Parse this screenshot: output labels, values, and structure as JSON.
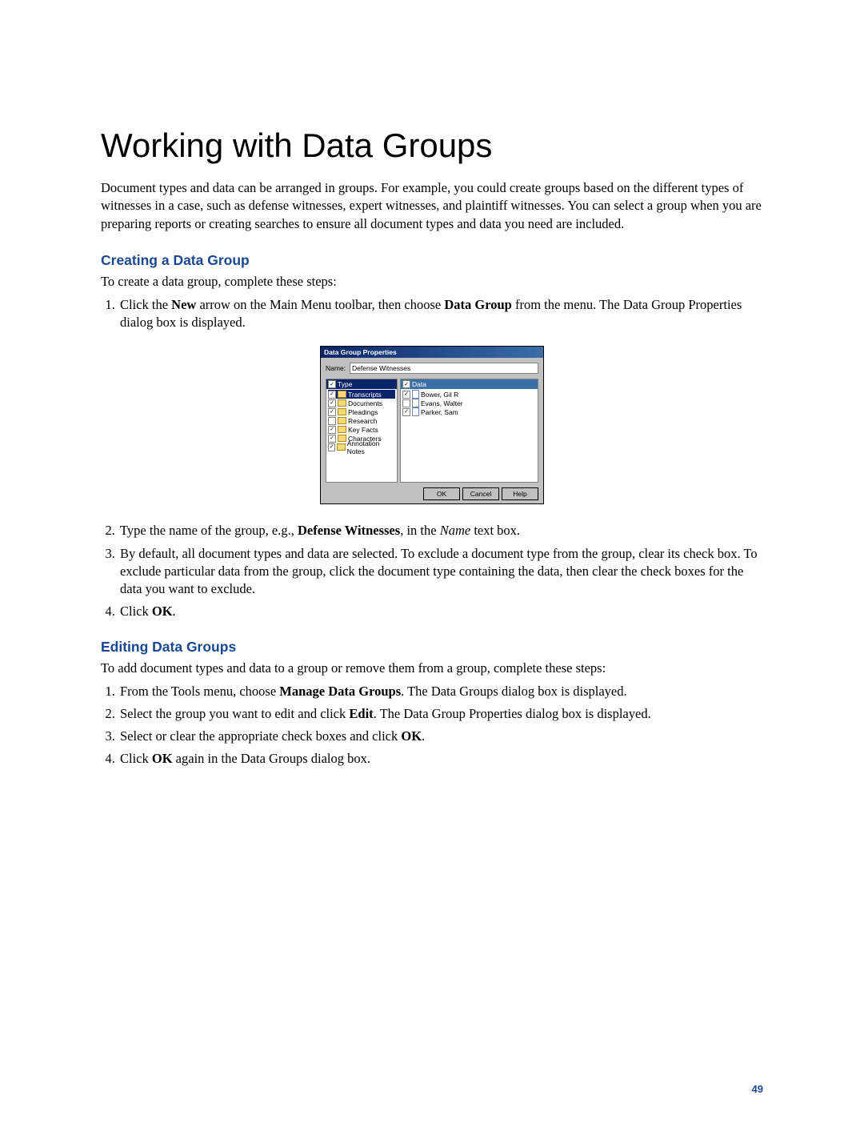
{
  "title": "Working with Data Groups",
  "intro": "Document types and data can be arranged in groups. For example, you could create groups based on the different types of witnesses in a case, such as defense witnesses, expert witnesses, and plaintiff witnesses. You can select a group when you are preparing reports or creating searches to ensure all document types and data you need are included.",
  "section_create": {
    "heading": "Creating a Data Group",
    "lead": "To create a data group, complete these steps:",
    "steps": {
      "s1_a": "Click the ",
      "s1_b": "New",
      "s1_c": " arrow on the Main Menu toolbar, then choose ",
      "s1_d": "Data Group",
      "s1_e": " from the menu. The Data Group Properties dialog box is displayed.",
      "s2_a": "Type the name of the group, e.g., ",
      "s2_b": "Defense Witnesses",
      "s2_c": ", in the ",
      "s2_d": "Name",
      "s2_e": " text box.",
      "s3": "By default, all document types and data are selected. To exclude a document type from the group, clear its check box. To exclude particular data from the group, click the document type containing the data, then clear the check boxes for the data you want to exclude.",
      "s4_a": "Click ",
      "s4_b": "OK",
      "s4_c": "."
    }
  },
  "section_edit": {
    "heading": "Editing Data Groups",
    "lead": "To add document types and data to a group or remove them from a group, complete these steps:",
    "steps": {
      "s1_a": "From the Tools menu, choose ",
      "s1_b": "Manage Data Groups",
      "s1_c": ". The Data Groups dialog box is displayed.",
      "s2_a": "Select the group you want to edit and click ",
      "s2_b": "Edit",
      "s2_c": ". The Data Group Properties dialog box is displayed.",
      "s3_a": "Select or clear the appropriate check boxes and click ",
      "s3_b": "OK",
      "s3_c": ".",
      "s4_a": "Click ",
      "s4_b": "OK",
      "s4_c": " again in the Data Groups dialog box."
    }
  },
  "dialog": {
    "title": "Data Group Properties",
    "name_label": "Name:",
    "name_value": "Defense Witnesses",
    "type_label": "Type",
    "data_label": "Data",
    "types": [
      {
        "label": "Transcripts",
        "checked": true,
        "selected": true
      },
      {
        "label": "Documents",
        "checked": true
      },
      {
        "label": "Pleadings",
        "checked": true
      },
      {
        "label": "Research",
        "checked": false
      },
      {
        "label": "Key Facts",
        "checked": true
      },
      {
        "label": "Characters",
        "checked": true
      },
      {
        "label": "Annotation Notes",
        "checked": true
      }
    ],
    "data_items": [
      {
        "label": "Bower, Gil R",
        "checked": true
      },
      {
        "label": "Evans, Walter",
        "checked": false
      },
      {
        "label": "Parker, Sam",
        "checked": true
      }
    ],
    "buttons": {
      "ok": "OK",
      "cancel": "Cancel",
      "help": "Help"
    }
  },
  "page_number": "49"
}
